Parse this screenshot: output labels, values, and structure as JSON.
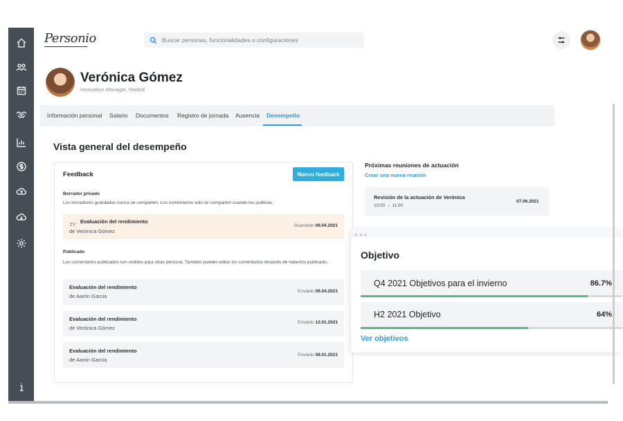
{
  "app": {
    "logo": "Personio"
  },
  "search": {
    "placeholder": "Buscar personas, funcionalidades o configuraciones"
  },
  "sidebar": {
    "icons": [
      "home-icon",
      "people-icon",
      "calendar-icon",
      "handshake-icon",
      "chart-icon",
      "dollar-icon",
      "cloud-upload-icon",
      "cloud-download-icon",
      "gear-icon",
      "info-icon"
    ]
  },
  "profile": {
    "name": "Verónica Gómez",
    "subtitle": "Innovation Manager, Madrid"
  },
  "tabs": [
    {
      "label": "Información personal"
    },
    {
      "label": "Salario"
    },
    {
      "label": "Documentos"
    },
    {
      "label": "Registro de jornada"
    },
    {
      "label": "Ausencia"
    },
    {
      "label": "Desempeño",
      "active": true
    }
  ],
  "main": {
    "title": "Vista general del desempeño"
  },
  "feedback": {
    "title": "Feedback",
    "new_button": "Nuevo feedback",
    "draft_heading": "Borrador privado",
    "draft_text": "Los borradores guardados nunca se comparten. Los comentarios solo se comparten cuando los publicas.",
    "draft_item": {
      "title": "Evaluación del rendimiento",
      "subtitle": "de Verónica Gómez",
      "status": "Guardado",
      "date": "09.04.2021"
    },
    "published_heading": "Publicado",
    "published_text": "Los comentarios publicados son visibles para otras persona. También puedes editar los comentarios después de haberlos publicado.",
    "published_items": [
      {
        "title": "Evaluación del rendimiento",
        "subtitle": "de Aarón Garcia",
        "status": "Enviado",
        "date": "09.04.2021"
      },
      {
        "title": "Evaluación del rendimiento",
        "subtitle": "de Verónica Gómez",
        "status": "Enviado",
        "date": "13.01.2021"
      },
      {
        "title": "Evaluación del rendimiento",
        "subtitle": "de Aarón Garcia",
        "status": "Enviado",
        "date": "08.01.2021"
      }
    ]
  },
  "meetings": {
    "title": "Próximas reuniones de actuación",
    "create_link": "Crear una nueva reunión",
    "items": [
      {
        "title": "Revisión de la actuación de Verónica",
        "time": "10:00 → 11:00",
        "date": "07.06.2021"
      }
    ]
  },
  "objectives": {
    "title": "Objetivo",
    "items": [
      {
        "name": "Q4 2021 Objetivos para el invierno",
        "percent_label": "86.7%",
        "progress": 0.867
      },
      {
        "name": "H2 2021 Objetivo",
        "percent_label": "64%",
        "progress": 0.64
      }
    ],
    "link": "Ver objetivos"
  },
  "colors": {
    "accent": "#2d9bd6",
    "button": "#2eaee0",
    "progress": "#4cc07a",
    "sidebar": "#474d55",
    "draft_bg": "#fdf1e6"
  }
}
